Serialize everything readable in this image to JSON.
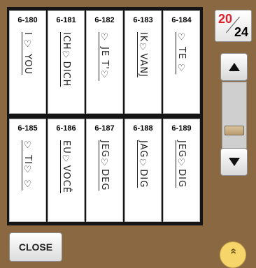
{
  "patterns": [
    {
      "code": "6-180",
      "text": "I ♡ YOU"
    },
    {
      "code": "6-181",
      "text": "ICH♡DICH"
    },
    {
      "code": "6-182",
      "text": "♡ JE T'♡"
    },
    {
      "code": "6-183",
      "text": "IK♡VANJ"
    },
    {
      "code": "6-184",
      "text": "♡ TE ♡"
    },
    {
      "code": "6-185",
      "text": "♡ TI♡ ♡"
    },
    {
      "code": "6-186",
      "text": "EU♡VOCÊ"
    },
    {
      "code": "6-187",
      "text": "JEG♡DEG"
    },
    {
      "code": "6-188",
      "text": "JAG♡DIG"
    },
    {
      "code": "6-189",
      "text": "JEG♡DIG"
    }
  ],
  "page": {
    "current": "20",
    "total": "24"
  },
  "scroll": {
    "position_fraction": 0.72
  },
  "buttons": {
    "close": "CLOSE",
    "expand_icon": "«"
  },
  "icons": {
    "up": "triangle-up-icon",
    "down": "triangle-down-icon",
    "expand": "double-chevron-up-icon"
  }
}
